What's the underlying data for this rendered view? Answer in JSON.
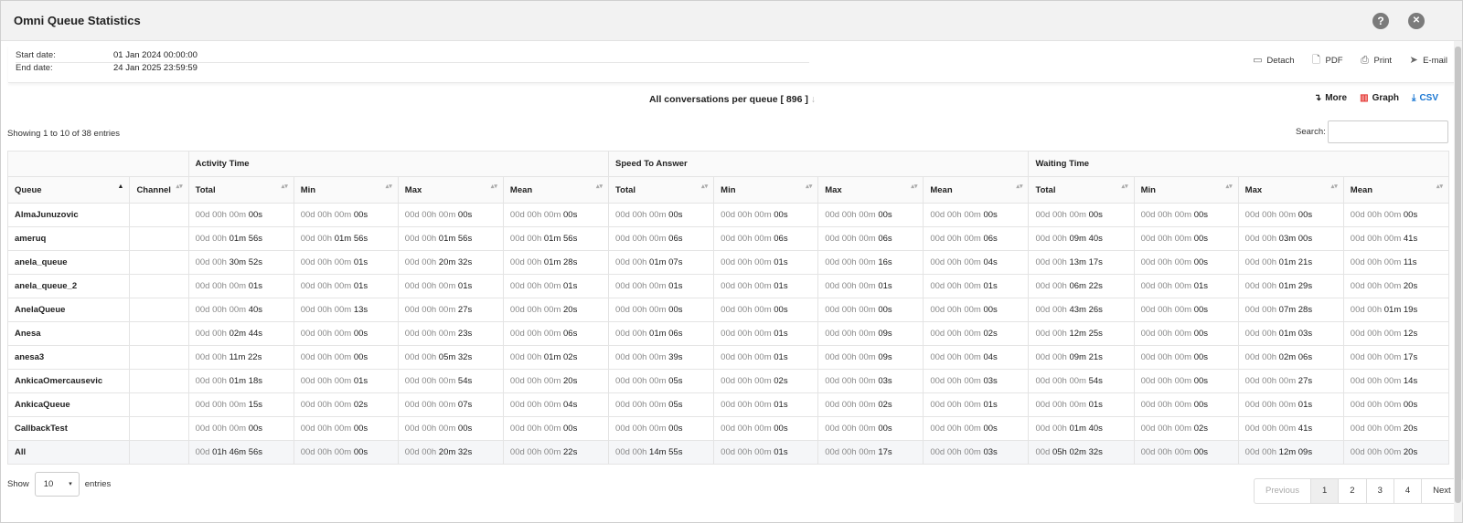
{
  "window": {
    "title": "Omni Queue Statistics",
    "help_glyph": "?",
    "close_glyph": "✕"
  },
  "info": {
    "start_label": "Start date:",
    "start_value": "01 Jan 2024 00:00:00",
    "end_label": "End date:",
    "end_value": "24 Jan 2025 23:59:59"
  },
  "actions": {
    "detach": "Detach",
    "pdf": "PDF",
    "print": "Print",
    "email": "E-mail"
  },
  "report": {
    "title": "All conversations per queue [ 896 ]",
    "arrow": "↓"
  },
  "tools": {
    "more": "More",
    "graph": "Graph",
    "csv": "CSV"
  },
  "colors": {
    "graph": "#e53935",
    "csv": "#1976d2",
    "accent_text": "#222222",
    "muted_text": "#888888"
  },
  "showing": "Showing 1 to 10 of 38 entries",
  "search": {
    "label": "Search:",
    "value": ""
  },
  "table": {
    "groups": {
      "activity": "Activity Time",
      "speed": "Speed To Answer",
      "waiting": "Waiting Time"
    },
    "columns": [
      "Queue",
      "Channel",
      "Total",
      "Min",
      "Max",
      "Mean",
      "Total",
      "Min",
      "Max",
      "Mean",
      "Total",
      "Min",
      "Max",
      "Mean"
    ],
    "rows": [
      {
        "q": "AlmaJunuzovic",
        "ch": "",
        "v": [
          "00d 00h 00m 00s",
          "00d 00h 00m 00s",
          "00d 00h 00m 00s",
          "00d 00h 00m 00s",
          "00d 00h 00m 00s",
          "00d 00h 00m 00s",
          "00d 00h 00m 00s",
          "00d 00h 00m 00s",
          "00d 00h 00m 00s",
          "00d 00h 00m 00s",
          "00d 00h 00m 00s",
          "00d 00h 00m 00s"
        ]
      },
      {
        "q": "ameruq",
        "ch": "",
        "v": [
          "00d 00h 01m 56s",
          "00d 00h 01m 56s",
          "00d 00h 01m 56s",
          "00d 00h 01m 56s",
          "00d 00h 00m 06s",
          "00d 00h 00m 06s",
          "00d 00h 00m 06s",
          "00d 00h 00m 06s",
          "00d 00h 09m 40s",
          "00d 00h 00m 00s",
          "00d 00h 03m 00s",
          "00d 00h 00m 41s"
        ]
      },
      {
        "q": "anela_queue",
        "ch": "",
        "v": [
          "00d 00h 30m 52s",
          "00d 00h 00m 01s",
          "00d 00h 20m 32s",
          "00d 00h 01m 28s",
          "00d 00h 01m 07s",
          "00d 00h 00m 01s",
          "00d 00h 00m 16s",
          "00d 00h 00m 04s",
          "00d 00h 13m 17s",
          "00d 00h 00m 00s",
          "00d 00h 01m 21s",
          "00d 00h 00m 11s"
        ]
      },
      {
        "q": "anela_queue_2",
        "ch": "",
        "v": [
          "00d 00h 00m 01s",
          "00d 00h 00m 01s",
          "00d 00h 00m 01s",
          "00d 00h 00m 01s",
          "00d 00h 00m 01s",
          "00d 00h 00m 01s",
          "00d 00h 00m 01s",
          "00d 00h 00m 01s",
          "00d 00h 06m 22s",
          "00d 00h 00m 01s",
          "00d 00h 01m 29s",
          "00d 00h 00m 20s"
        ]
      },
      {
        "q": "AnelaQueue",
        "ch": "",
        "v": [
          "00d 00h 00m 40s",
          "00d 00h 00m 13s",
          "00d 00h 00m 27s",
          "00d 00h 00m 20s",
          "00d 00h 00m 00s",
          "00d 00h 00m 00s",
          "00d 00h 00m 00s",
          "00d 00h 00m 00s",
          "00d 00h 43m 26s",
          "00d 00h 00m 00s",
          "00d 00h 07m 28s",
          "00d 00h 01m 19s"
        ]
      },
      {
        "q": "Anesa",
        "ch": "",
        "v": [
          "00d 00h 02m 44s",
          "00d 00h 00m 00s",
          "00d 00h 00m 23s",
          "00d 00h 00m 06s",
          "00d 00h 01m 06s",
          "00d 00h 00m 01s",
          "00d 00h 00m 09s",
          "00d 00h 00m 02s",
          "00d 00h 12m 25s",
          "00d 00h 00m 00s",
          "00d 00h 01m 03s",
          "00d 00h 00m 12s"
        ]
      },
      {
        "q": "anesa3",
        "ch": "",
        "v": [
          "00d 00h 11m 22s",
          "00d 00h 00m 00s",
          "00d 00h 05m 32s",
          "00d 00h 01m 02s",
          "00d 00h 00m 39s",
          "00d 00h 00m 01s",
          "00d 00h 00m 09s",
          "00d 00h 00m 04s",
          "00d 00h 09m 21s",
          "00d 00h 00m 00s",
          "00d 00h 02m 06s",
          "00d 00h 00m 17s"
        ]
      },
      {
        "q": "AnkicaOmercausevic",
        "ch": "",
        "v": [
          "00d 00h 01m 18s",
          "00d 00h 00m 01s",
          "00d 00h 00m 54s",
          "00d 00h 00m 20s",
          "00d 00h 00m 05s",
          "00d 00h 00m 02s",
          "00d 00h 00m 03s",
          "00d 00h 00m 03s",
          "00d 00h 00m 54s",
          "00d 00h 00m 00s",
          "00d 00h 00m 27s",
          "00d 00h 00m 14s"
        ]
      },
      {
        "q": "AnkicaQueue",
        "ch": "",
        "v": [
          "00d 00h 00m 15s",
          "00d 00h 00m 02s",
          "00d 00h 00m 07s",
          "00d 00h 00m 04s",
          "00d 00h 00m 05s",
          "00d 00h 00m 01s",
          "00d 00h 00m 02s",
          "00d 00h 00m 01s",
          "00d 00h 00m 01s",
          "00d 00h 00m 00s",
          "00d 00h 00m 01s",
          "00d 00h 00m 00s"
        ]
      },
      {
        "q": "CallbackTest",
        "ch": "",
        "v": [
          "00d 00h 00m 00s",
          "00d 00h 00m 00s",
          "00d 00h 00m 00s",
          "00d 00h 00m 00s",
          "00d 00h 00m 00s",
          "00d 00h 00m 00s",
          "00d 00h 00m 00s",
          "00d 00h 00m 00s",
          "00d 00h 01m 40s",
          "00d 00h 00m 02s",
          "00d 00h 00m 41s",
          "00d 00h 00m 20s"
        ]
      }
    ],
    "total_row": {
      "q": "All",
      "ch": "",
      "v": [
        "00d 01h 46m 56s",
        "00d 00h 00m 00s",
        "00d 00h 20m 32s",
        "00d 00h 00m 22s",
        "00d 00h 14m 55s",
        "00d 00h 00m 01s",
        "00d 00h 00m 17s",
        "00d 00h 00m 03s",
        "00d 05h 02m 32s",
        "00d 00h 00m 00s",
        "00d 00h 12m 09s",
        "00d 00h 00m 20s"
      ]
    }
  },
  "length": {
    "show": "Show",
    "value": "10",
    "entries": "entries"
  },
  "pagination": [
    "Previous",
    "1",
    "2",
    "3",
    "4",
    "Next"
  ]
}
